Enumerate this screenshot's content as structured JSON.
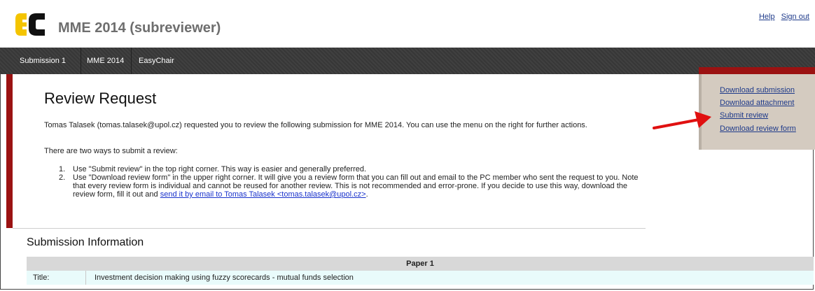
{
  "header": {
    "app_title": "MME 2014 (subreviewer)",
    "links": [
      "Help",
      "Sign out"
    ]
  },
  "menu": [
    "Submission 1",
    "MME 2014",
    "EasyChair"
  ],
  "main": {
    "title": "Review Request",
    "intro": "Tomas Talasek (tomas.talasek@upol.cz) requested you to review the following submission for MME 2014. You can use the menu on the right for further actions.",
    "ways": "There are two ways to submit a review:",
    "steps": [
      "Use \"Submit review\" in the top right corner. This way is easier and generally preferred.",
      "Use \"Download review form\" in the upper right corner. It will give you a review form that you can fill out and email to the PC member who sent the request to you. Note that every review form is individual and cannot be reused for another review. This is not recommended and error-prone. If you decide to use this way, download the review form, fill it out and "
    ],
    "step_numbers": [
      "1.",
      "2."
    ],
    "email_link": "send it by email to Tomas Talasek <tomas.talasek@upol.cz>",
    "email_link_end": "."
  },
  "side_menu": [
    "Download submission",
    "Download attachment",
    "Submit review",
    "Download review form"
  ],
  "submission": {
    "title": "Submission Information",
    "table_header": "Paper 1",
    "row_label": "Title:",
    "row_value": "Investment decision making using fuzzy scorecards - mutual funds selection"
  },
  "colors": {
    "accent_red": "#9b1212",
    "menubar": "#3a3a3a",
    "side_bg": "#d4cbc0",
    "link": "#1e3a8a"
  },
  "icons": {
    "logo": "easychair-logo",
    "annotation": "red-arrow-icon"
  }
}
